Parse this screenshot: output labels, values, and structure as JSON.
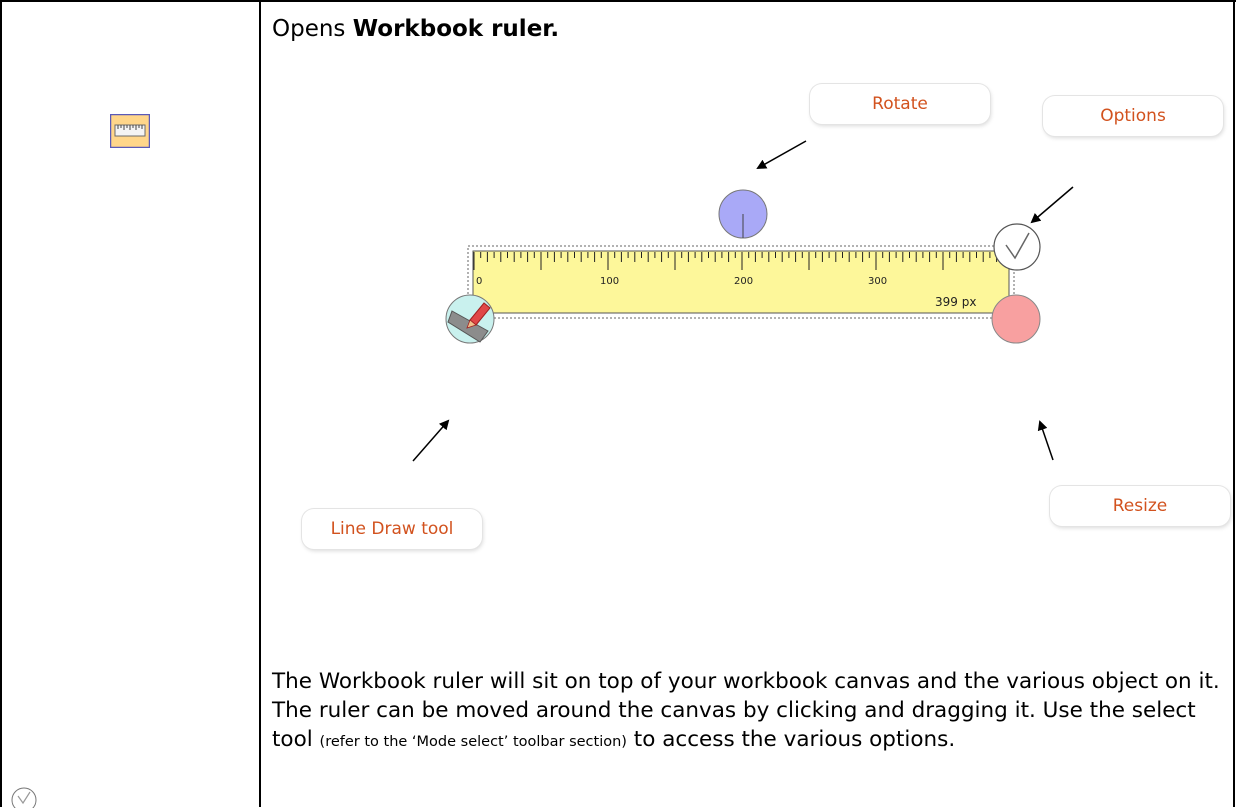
{
  "heading": {
    "prefix": "Opens ",
    "bold": "Workbook ruler."
  },
  "icons": {
    "toolbar_icon": "ruler-icon",
    "bottom_icon": "check-circle-icon"
  },
  "callouts": {
    "rotate": "Rotate",
    "options": "Options",
    "line_draw": "Line Draw tool",
    "resize": "Resize"
  },
  "ruler": {
    "tick_labels": [
      "0",
      "100",
      "200",
      "300"
    ],
    "length_readout": "399 px",
    "colors": {
      "body": "#fdf79a",
      "rotate_handle": "#a9a9f7",
      "resize_handle": "#f8a0a0",
      "line_draw_handle": "#c9f1ee"
    }
  },
  "description": {
    "part1": "The Workbook ruler will sit on top of your workbook canvas and the various object on it.  The ruler can be moved around the canvas by clicking and dragging it. Use the select tool ",
    "small": "(refer to the ‘Mode select’ toolbar section)",
    "part2": " to access the various options."
  },
  "accent_color": "#d2521e"
}
